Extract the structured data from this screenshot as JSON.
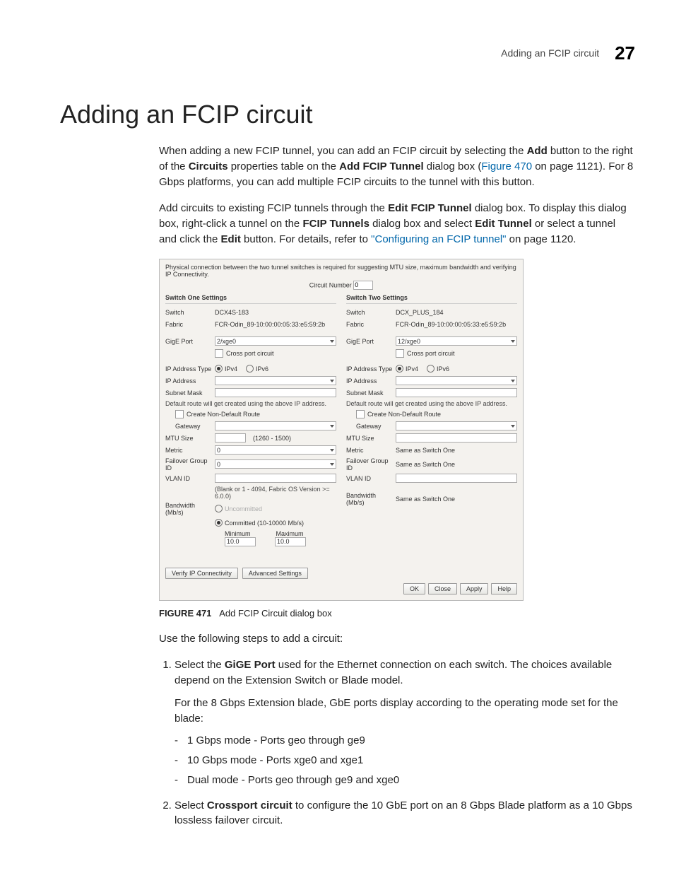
{
  "header": {
    "title": "Adding an FCIP circuit",
    "chapter": "27"
  },
  "h1": "Adding an FCIP circuit",
  "para1_a": "When adding a new FCIP tunnel, you can add an FCIP circuit by selecting the ",
  "para1_b": " button to the right of the ",
  "para1_c": " properties table on the ",
  "para1_d": " dialog box (",
  "para1_link": "Figure 470",
  "para1_e": " on page 1121). For 8 Gbps platforms, you can add multiple FCIP circuits to the tunnel with this button.",
  "bold": {
    "add": "Add",
    "circuits": "Circuits",
    "addFcipTunnel": "Add FCIP Tunnel",
    "editFcipTunnel": "Edit FCIP Tunnel",
    "fcipTunnels": "FCIP Tunnels",
    "editTunnel": "Edit Tunnel",
    "edit": "Edit",
    "gigePort": "GiGE Port",
    "crossport": "Crossport circuit"
  },
  "para2_a": "Add circuits to existing FCIP tunnels through the ",
  "para2_b": " dialog box. To display this dialog box, right-click a tunnel on the ",
  "para2_c": " dialog box and select ",
  "para2_d": " or select a tunnel and click the ",
  "para2_e": " button. For details, refer to ",
  "para2_link": "\"Configuring an FCIP tunnel\"",
  "para2_f": " on page 1120.",
  "dialog": {
    "topline": "Physical connection between the two tunnel switches is required for suggesting MTU size, maximum bandwidth and verifying IP Connectivity.",
    "circNumLabel": "Circuit Number",
    "circNumValue": "0",
    "switch1": {
      "heading": "Switch One Settings",
      "switchLabel": "Switch",
      "switchValue": "DCX4S-183",
      "fabricLabel": "Fabric",
      "fabricValue": "FCR-Odin_89-10:00:00:05:33:e5:59:2b",
      "gigeLabel": "GigE Port",
      "gigeValue": "2/xge0",
      "crossport": "Cross port circuit",
      "ipTypeLabel": "IP Address Type",
      "ipv4": "IPv4",
      "ipv6": "IPv6",
      "ipAddrLabel": "IP Address",
      "subnetLabel": "Subnet Mask",
      "routeNote": "Default route will get created using the above IP address.",
      "createRoute": "Create Non-Default Route",
      "gatewayLabel": "Gateway",
      "mtuLabel": "MTU Size",
      "mtuHint": "(1260 - 1500)",
      "metricLabel": "Metric",
      "metricValue": "0",
      "failoverLabel": "Failover Group ID",
      "failoverValue": "0",
      "vlanLabel": "VLAN ID",
      "vlanHint": "(Blank or 1 - 4094, Fabric OS Version >= 6.0.0)",
      "bwLabel": "Bandwidth (Mb/s)",
      "uncommitted": "Uncommitted",
      "committed": "Committed (10-10000 Mb/s)",
      "minLabel": "Minimum",
      "maxLabel": "Maximum",
      "minVal": "10.0",
      "maxVal": "10.0"
    },
    "switch2": {
      "heading": "Switch Two Settings",
      "switchLabel": "Switch",
      "switchValue": "DCX_PLUS_184",
      "fabricLabel": "Fabric",
      "fabricValue": "FCR-Odin_89-10:00:00:05:33:e5:59:2b",
      "gigeLabel": "GigE Port",
      "gigeValue": "12/xge0",
      "crossport": "Cross port circuit",
      "ipTypeLabel": "IP Address Type",
      "ipv4": "IPv4",
      "ipv6": "IPv6",
      "ipAddrLabel": "IP Address",
      "subnetLabel": "Subnet Mask",
      "routeNote": "Default route will get created using the above IP address.",
      "createRoute": "Create Non-Default Route",
      "gatewayLabel": "Gateway",
      "mtuLabel": "MTU Size",
      "metricLabel": "Metric",
      "metricValue": "Same as Switch One",
      "failoverLabel": "Failover Group ID",
      "failoverValue": "Same as Switch One",
      "vlanLabel": "VLAN ID",
      "bwLabel": "Bandwidth (Mb/s)",
      "bwValue": "Same as Switch One"
    },
    "verifyBtn": "Verify IP Connectivity",
    "advBtn": "Advanced Settings",
    "ok": "OK",
    "close": "Close",
    "apply": "Apply",
    "help": "Help"
  },
  "figCaption": {
    "num": "FIGURE 471",
    "text": "Add FCIP Circuit dialog box"
  },
  "useSteps": "Use the following steps to add a circuit:",
  "step1_a": "Select the ",
  "step1_b": " used for the Ethernet connection on each switch. The choices available depend on the Extension Switch or Blade model.",
  "step1_sub": "For the 8 Gbps Extension blade, GbE ports display according to the operating mode set for the blade:",
  "step1_items": [
    "1 Gbps mode - Ports geo through ge9",
    "10 Gbps mode - Ports xge0 and xge1",
    "Dual mode - Ports geo through ge9 and xge0"
  ],
  "step2_a": "Select ",
  "step2_b": " to configure the 10 GbE port on an 8 Gbps Blade platform as a 10 Gbps lossless failover circuit."
}
